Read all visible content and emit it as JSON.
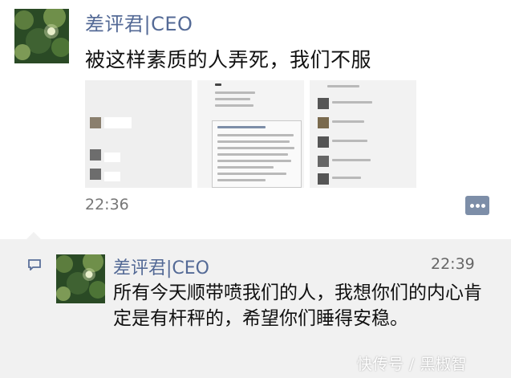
{
  "post": {
    "author": "差评君|CEO",
    "text": "被这样素质的人弄死，我们不服",
    "time": "22:36",
    "more_icon": "ellipsis-icon",
    "images": [
      {
        "name": "screenshot-chat-1"
      },
      {
        "name": "screenshot-chat-2"
      },
      {
        "name": "screenshot-chat-3"
      }
    ]
  },
  "comment": {
    "icon": "comment-icon",
    "author": "差评君|CEO",
    "time": "22:39",
    "text": "所有今天顺带喷我们的人，我想你们的内心肯定是有杆秤的，希望你们睡得安稳。"
  },
  "watermark": "快传号 / 黑椒智",
  "colors": {
    "name": "#546a96",
    "comment_bg": "#f1f1f1",
    "more_button": "#7d8ea8"
  }
}
